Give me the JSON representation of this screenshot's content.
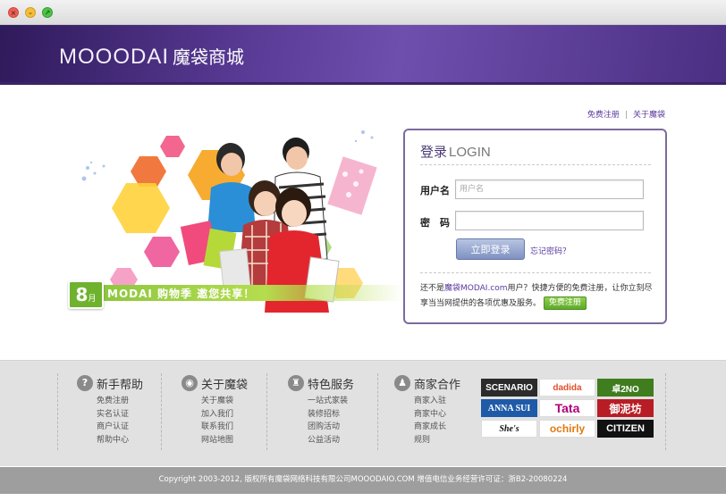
{
  "window": {
    "close_glyph": "×",
    "minimize_glyph": "–",
    "maximize_glyph": "↗"
  },
  "header": {
    "logo_en": "MOOODAI",
    "logo_cn": "魔袋商城"
  },
  "top_links": {
    "register": "免费注册",
    "separator": "|",
    "about": "关于魔袋"
  },
  "banner": {
    "badge_num": "8",
    "badge_unit": "月",
    "text": "MODAI 购物季 邀您共享！"
  },
  "login": {
    "title_cn": "登录",
    "title_en": "LOGIN",
    "username_label": "用户名",
    "username_placeholder": "用户名",
    "password_label": "密　码",
    "submit_label": "立即登录",
    "forgot_label": "忘记密码？",
    "register_prefix": "还不是",
    "register_site": "魔袋MODAI.com",
    "register_text": "用户？快捷方便的免费注册，让你立刻尽享当当网提供的各项优惠及服务。",
    "register_button": "免费注册"
  },
  "footer": {
    "columns": [
      {
        "icon": "?",
        "title": "新手帮助",
        "links": [
          "免费注册",
          "实名认证",
          "商户认证",
          "帮助中心"
        ]
      },
      {
        "icon": "◉",
        "title": "关于魔袋",
        "links": [
          "关于魔袋",
          "加入我们",
          "联系我们",
          "网站地图"
        ]
      },
      {
        "icon": "♜",
        "title": "特色服务",
        "links": [
          "一站式家装",
          "装修招标",
          "团购活动",
          "公益活动"
        ]
      },
      {
        "icon": "♟",
        "title": "商家合作",
        "links": [
          "商家入驻",
          "商家中心",
          "商家成长",
          "规则"
        ]
      }
    ],
    "brands": [
      "SCENARIO",
      "dadida",
      "卓2NO",
      "ANNA SUI",
      "Tata",
      "御泥坊",
      "She's",
      "ochirly",
      "CITIZEN"
    ],
    "brand_colors": [
      "#2b2b2b",
      "#ffffff",
      "#3f7d1e",
      "#1e5aa8",
      "#ffffff",
      "#b81d25",
      "#ffffff",
      "#ffffff",
      "#111111"
    ]
  },
  "copyright": "Copyright 2003-2012, 版权所有魔袋网络科技有限公司MOOODAIO.COM  增值电信业务经营许可证：浙B2-20080224"
}
